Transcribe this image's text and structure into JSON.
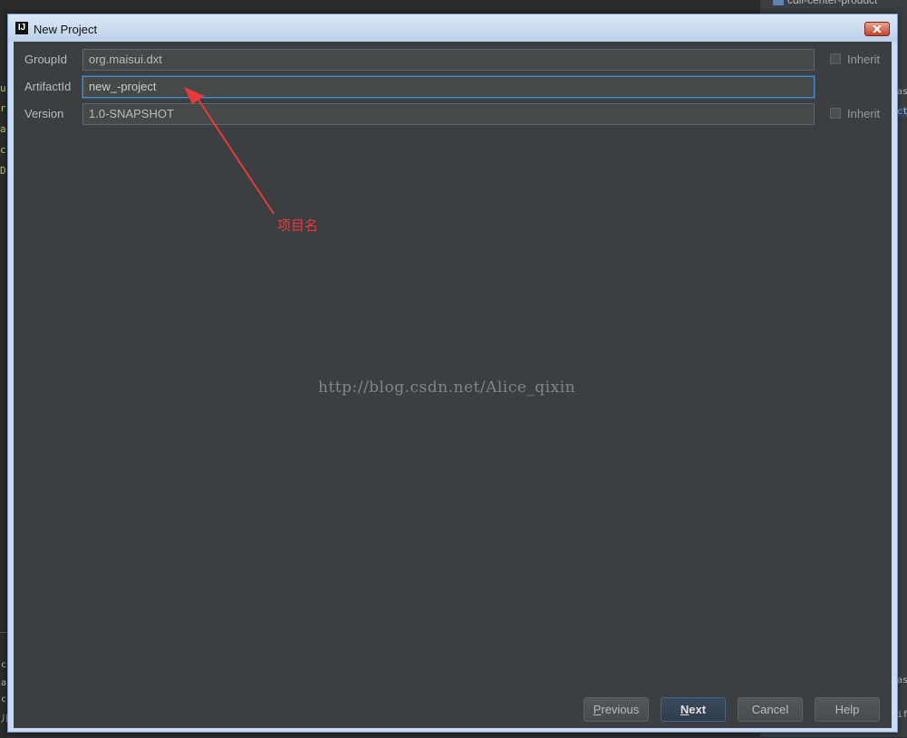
{
  "dialog": {
    "title": "New Project",
    "app_icon": "IJ"
  },
  "form": {
    "group_id": {
      "label": "GroupId",
      "value": "org.maisui.dxt",
      "inherit_label": "Inherit",
      "inherit_checked": false
    },
    "artifact_id": {
      "label": "ArtifactId",
      "value": "new_-project"
    },
    "version": {
      "label": "Version",
      "value": "1.0-SNAPSHOT",
      "inherit_label": "Inherit",
      "inherit_checked": false
    }
  },
  "annotation": {
    "text": "项目名",
    "color": "#e83a3a"
  },
  "watermark": "http://blog.csdn.net/Alice_qixin",
  "buttons": {
    "previous": {
      "mnemonic": "P",
      "rest": "revious"
    },
    "next": {
      "mnemonic": "N",
      "rest": "ext"
    },
    "cancel": "Cancel",
    "help": "Help"
  },
  "background": {
    "tree_item": "cdli-center-product",
    "editor_glyphs": [
      "u",
      "r",
      "a",
      "c",
      "D"
    ],
    "bottom_glyphs": [
      "c",
      "a",
      "c",
      "儿"
    ],
    "right_edge_glyphs": [
      "as",
      "ct",
      "as",
      "if"
    ]
  },
  "colors": {
    "dialog_bg": "#3c3f41",
    "titlebar": "#c9dcf2",
    "focus_border": "#4a88c7",
    "close_button": "#c5442c"
  }
}
